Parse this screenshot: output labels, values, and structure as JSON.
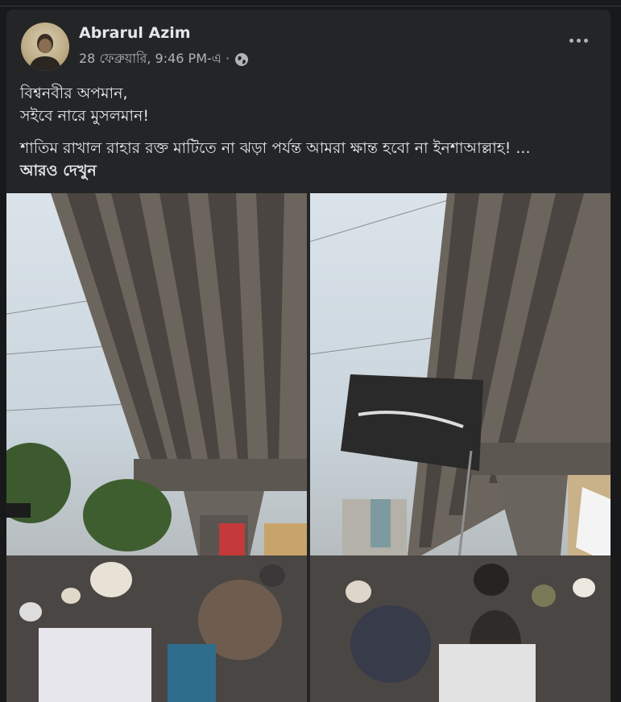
{
  "post": {
    "author": "Abrarul Azim",
    "timestamp": "28 ফেব্রুয়ারি, 9:46 PM-এ ·",
    "privacy_icon": "globe-icon",
    "more_icon": "more-horizontal-icon",
    "line1": "বিশ্বনবীর অপমান,",
    "line2": "সইবে নারে মুসলমান!",
    "line3": "শাতিম রাখাল রাহার রক্ত মাটিতে না ঝড়া পর্যন্ত আমরা ক্ষান্ত হবো না ইনশাআল্লাহ! ...",
    "see_more": "আরও দেখুন"
  },
  "colors": {
    "background": "#18191a",
    "card": "#242526",
    "text_primary": "#e4e6eb",
    "text_secondary": "#b0b3b8"
  }
}
